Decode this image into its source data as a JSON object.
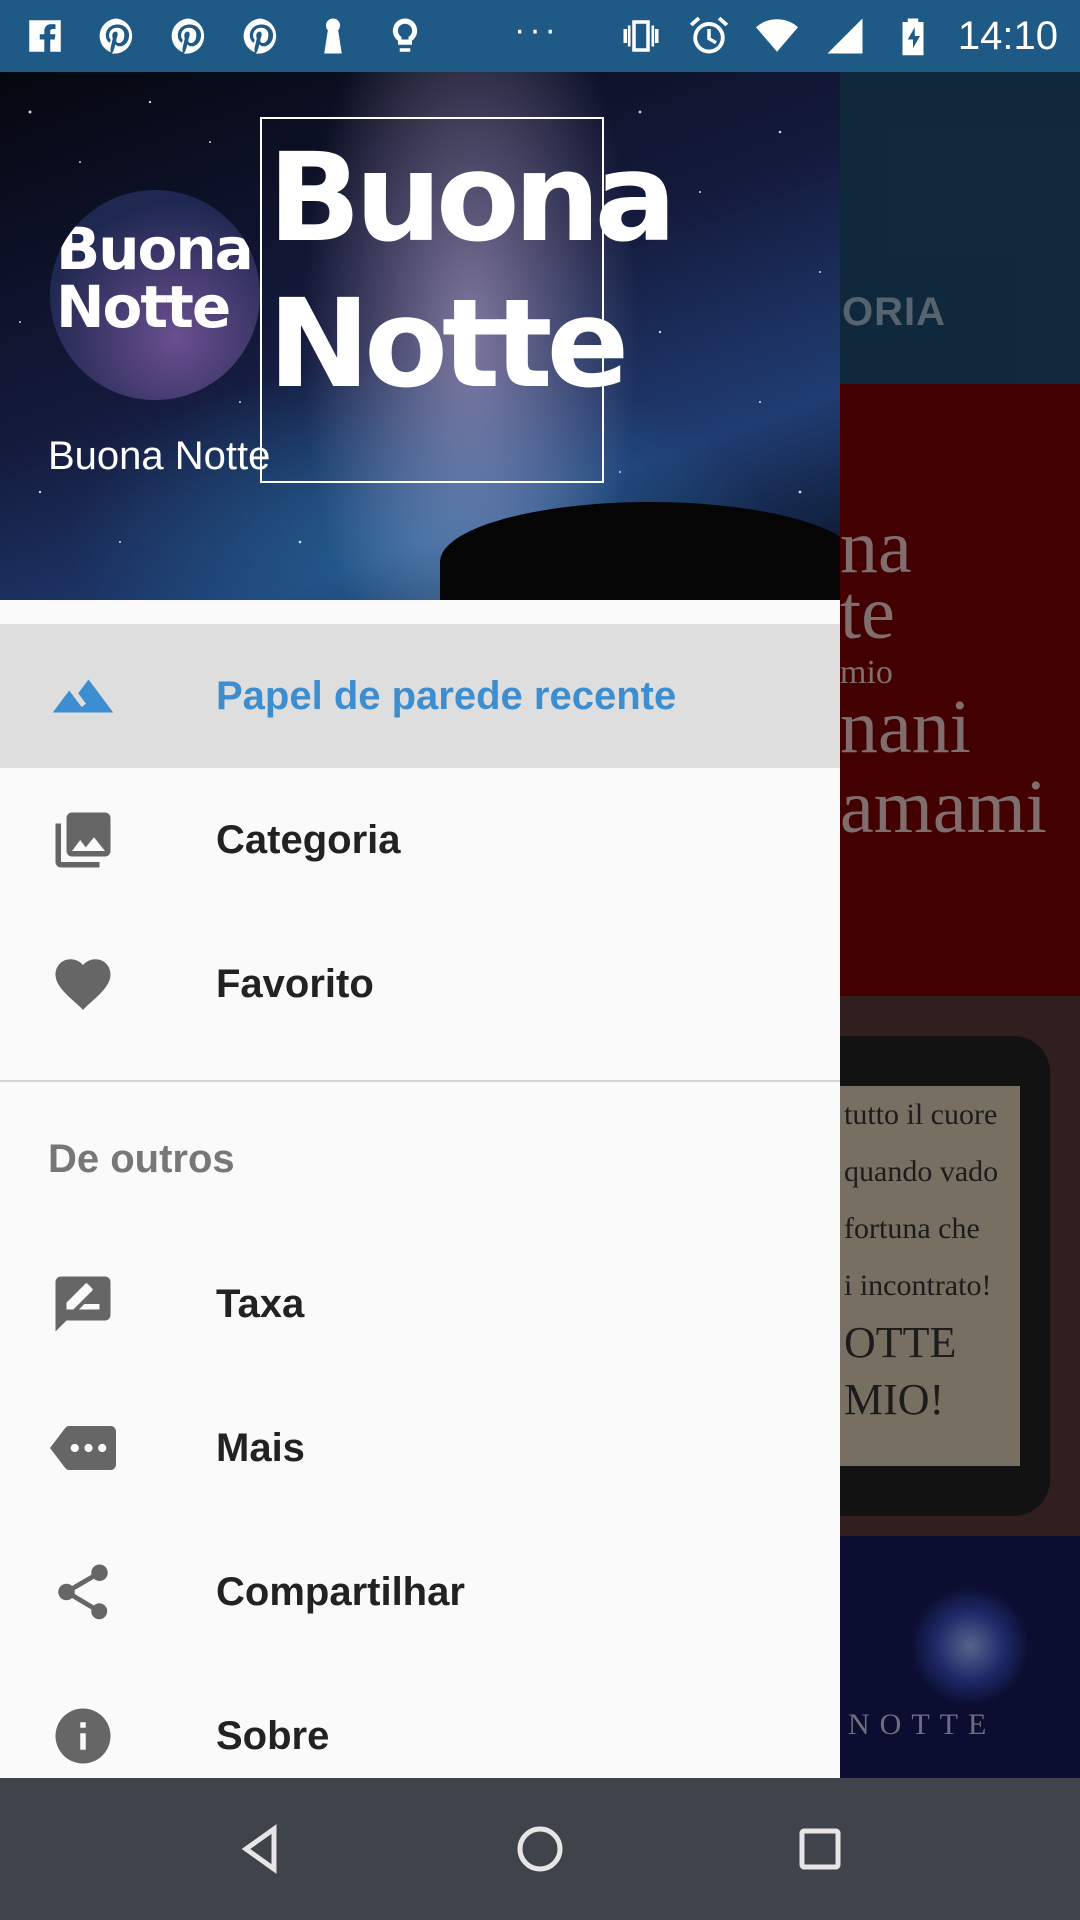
{
  "status_bar": {
    "time": "14:10",
    "notification_icons": [
      "facebook-icon",
      "pinterest-icon",
      "pinterest-icon",
      "pinterest-icon",
      "keyhole-icon",
      "lightbulb-icon"
    ],
    "overflow": "···",
    "system_icons": [
      "vibrate-icon",
      "alarm-icon",
      "wifi-icon",
      "signal-icon",
      "battery-charging-icon"
    ]
  },
  "background": {
    "tab_text": "ORIA",
    "card1_lines": [
      "na",
      "te",
      "mio",
      "nani",
      "amami"
    ],
    "card2_lines": [
      "tutto il cuore",
      "quando vado",
      "fortuna che",
      "i incontrato!",
      "OTTE",
      "MIO!"
    ],
    "card3_text": "NOTTE"
  },
  "drawer": {
    "header": {
      "logo_line1": "Buona",
      "logo_line2": "Notte",
      "name": "Buona Notte"
    },
    "items": [
      {
        "label": "Papel de parede recente",
        "icon": "landscape-icon",
        "active": true
      },
      {
        "label": "Categoria",
        "icon": "photo-library-icon",
        "active": false
      },
      {
        "label": "Favorito",
        "icon": "heart-icon",
        "active": false
      }
    ],
    "section_title": "De outros",
    "other_items": [
      {
        "label": "Taxa",
        "icon": "rate-review-icon"
      },
      {
        "label": "Mais",
        "icon": "more-tag-icon"
      },
      {
        "label": "Compartilhar",
        "icon": "share-icon"
      },
      {
        "label": "Sobre",
        "icon": "info-icon"
      }
    ]
  },
  "colors": {
    "status_bar": "#1f5a86",
    "accent": "#3d8ed0",
    "active_row": "#dedede",
    "nav_bar": "#3e4449"
  }
}
